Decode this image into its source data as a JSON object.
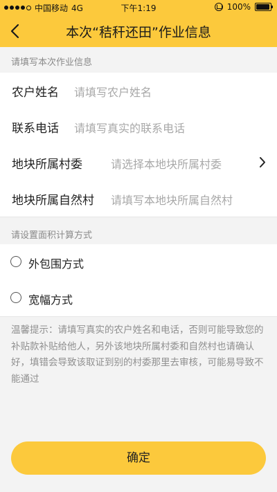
{
  "status_bar": {
    "carrier": "中国移动",
    "network": "4G",
    "time": "下午1:19",
    "battery_text": "100%",
    "battery_level": 1.0
  },
  "nav": {
    "title": "本次“秸秆还田”作业信息"
  },
  "form": {
    "section_label": "请填写本次作业信息",
    "fields": [
      {
        "label": "农户姓名",
        "placeholder": "请填写农户姓名"
      },
      {
        "label": "联系电话",
        "placeholder": "请填写真实的联系电话"
      },
      {
        "label": "地块所属村委",
        "placeholder": "请选择本地块所属村委"
      },
      {
        "label": "地块所属自然村",
        "placeholder": "请填写本地块所属自然村"
      }
    ]
  },
  "area": {
    "section_label": "请设置面积计算方式",
    "options": [
      {
        "label": "外包围方式",
        "selected": false
      },
      {
        "label": "宽幅方式",
        "selected": false
      }
    ]
  },
  "tip": "温馨提示：请填写真实的农户姓名和电话，否则可能导致您的补贴款补贴给他人，另外该地块所属村委和自然村也请确认好，填错会导致该取证到别的村委那里去审核，可能易导致不能通过",
  "confirm_label": "确定",
  "colors": {
    "accent": "#fcc93c",
    "background": "#f3f3f3",
    "placeholder": "#a8a8a8"
  }
}
